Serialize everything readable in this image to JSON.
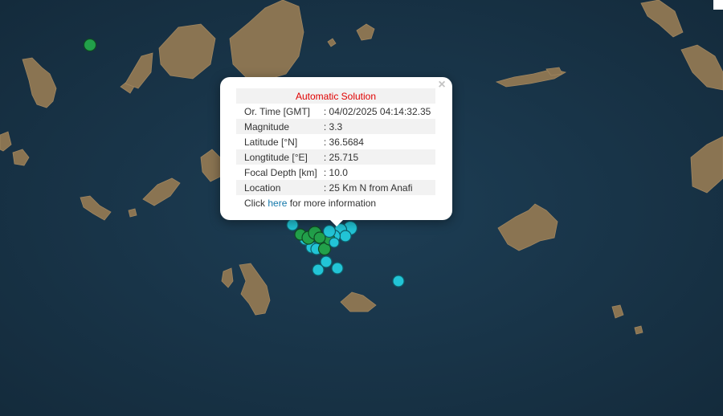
{
  "popup": {
    "title": "Automatic Solution",
    "rows": [
      {
        "label": "Or. Time [GMT]",
        "value": ": 04/02/2025 04:14:32.35"
      },
      {
        "label": "Magnitude",
        "value": ": 3.3"
      },
      {
        "label": "Latitude [°N]",
        "value": ": 36.5684"
      },
      {
        "label": "Longtitude [°E]",
        "value": ": 25.715"
      },
      {
        "label": "Focal Depth [km]",
        "value": ": 10.0"
      },
      {
        "label": "Location",
        "value": ": 25 Km N from Anafi"
      }
    ],
    "footer_prefix": "Click",
    "footer_link": "here",
    "footer_suffix": "for more information",
    "close_symbol": "×"
  },
  "map": {
    "sea_color": "#183347",
    "marker_colors": {
      "recent": "#22c4d6",
      "older": "#22a04a"
    }
  }
}
